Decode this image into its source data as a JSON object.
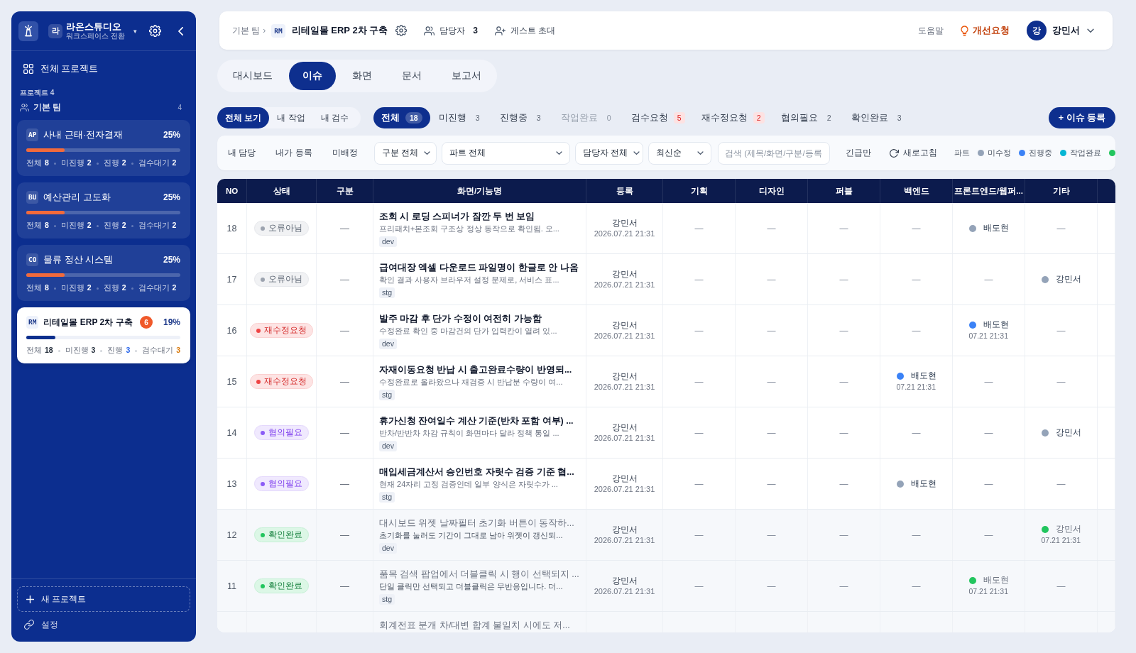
{
  "sidebar": {
    "workspace": {
      "initial": "라",
      "name": "라온스튜디오",
      "subtitle": "워크스페이스 전환",
      "caret": "▾"
    },
    "nav": {
      "label": "전체 프로젝트"
    },
    "section_label": "프로젝트 4",
    "team": {
      "name": "기본 팀",
      "count": "4"
    },
    "projects": [
      {
        "code": "AP",
        "name": "사내 근태·전자결재",
        "percent": "25%",
        "level": 0.25,
        "selected": false,
        "stats": [
          {
            "kind": "total",
            "label": "전체",
            "value": "8"
          },
          {
            "kind": "todo",
            "label": "미진행",
            "value": "2"
          },
          {
            "kind": "doing",
            "label": "진행",
            "value": "2"
          },
          {
            "kind": "review",
            "label": "검수대기",
            "value": "2"
          }
        ]
      },
      {
        "code": "BU",
        "name": "예산관리 고도화",
        "percent": "25%",
        "level": 0.25,
        "selected": false,
        "stats": [
          {
            "kind": "total",
            "label": "전체",
            "value": "8"
          },
          {
            "kind": "todo",
            "label": "미진행",
            "value": "2"
          },
          {
            "kind": "doing",
            "label": "진행",
            "value": "2"
          },
          {
            "kind": "review",
            "label": "검수대기",
            "value": "2"
          }
        ]
      },
      {
        "code": "CO",
        "name": "물류 정산 시스템",
        "percent": "25%",
        "level": 0.25,
        "selected": false,
        "stats": [
          {
            "kind": "total",
            "label": "전체",
            "value": "8"
          },
          {
            "kind": "todo",
            "label": "미진행",
            "value": "2"
          },
          {
            "kind": "doing",
            "label": "진행",
            "value": "2"
          },
          {
            "kind": "review",
            "label": "검수대기",
            "value": "2"
          }
        ]
      },
      {
        "code": "RM",
        "name": "리테일몰 ERP 2차 구축",
        "badge": "6",
        "percent": "19%",
        "level": 0.19,
        "selected": true,
        "stats": [
          {
            "kind": "total",
            "label": "전체",
            "value": "18"
          },
          {
            "kind": "todo",
            "label": "미진행",
            "value": "3"
          },
          {
            "kind": "doing",
            "label": "진행",
            "value": "3"
          },
          {
            "kind": "review",
            "label": "검수대기",
            "value": "3"
          }
        ]
      }
    ],
    "new_project": "새 프로젝트",
    "settings": "설정"
  },
  "topbar": {
    "breadcrumb": {
      "parent": "기본 팀",
      "separator": "›",
      "code": "RM",
      "title": "리테일몰 ERP 2차 구축"
    },
    "members": {
      "label": "담당자",
      "count": "3"
    },
    "invite": "게스트 초대",
    "help": "도움말",
    "feedback": "개선요청",
    "user": {
      "initial": "강",
      "name": "강민서"
    }
  },
  "tabs": [
    {
      "label": "대시보드",
      "selected": false
    },
    {
      "label": "이슈",
      "selected": true
    },
    {
      "label": "화면",
      "selected": false
    },
    {
      "label": "문서",
      "selected": false
    },
    {
      "label": "보고서",
      "selected": false
    }
  ],
  "scope_filters": [
    {
      "label": "전체 보기",
      "selected": true
    },
    {
      "label": "내 작업",
      "selected": false
    },
    {
      "label": "내 검수",
      "selected": false
    }
  ],
  "status_filters": [
    {
      "label": "전체",
      "count": "18",
      "selected": true,
      "alert": false,
      "disabled": false
    },
    {
      "label": "미진행",
      "count": "3",
      "selected": false,
      "alert": false,
      "disabled": false
    },
    {
      "label": "진행중",
      "count": "3",
      "selected": false,
      "alert": false,
      "disabled": false
    },
    {
      "label": "작업완료",
      "count": "0",
      "selected": false,
      "alert": false,
      "disabled": true
    },
    {
      "label": "검수요청",
      "count": "5",
      "selected": false,
      "alert": true,
      "disabled": false
    },
    {
      "label": "재수정요청",
      "count": "2",
      "selected": false,
      "alert": true,
      "disabled": false
    },
    {
      "label": "협의필요",
      "count": "2",
      "selected": false,
      "alert": false,
      "disabled": false
    },
    {
      "label": "확인완료",
      "count": "3",
      "selected": false,
      "alert": false,
      "disabled": false
    }
  ],
  "new_issue_button": "+ 이슈 등록",
  "toolbar": {
    "quick_filters": [
      "내 담당",
      "내가 등록",
      "미배정"
    ],
    "dropdowns": [
      {
        "label": "구분 전체"
      },
      {
        "label": "파트 전체"
      },
      {
        "label": "담당자 전체"
      },
      {
        "label": "최신순"
      }
    ],
    "search": {
      "placeholder": "검색 (제목/화면/구분/등록"
    },
    "urgent_toggle": "긴급만",
    "refresh": "새로고침",
    "legend": {
      "label": "파트",
      "items": [
        {
          "label": "미수정",
          "color": "#94a3b8"
        },
        {
          "label": "진행중",
          "color": "#3b82f6"
        },
        {
          "label": "작업완료",
          "color": "#06b6d4"
        },
        {
          "color": "#22c55e"
        }
      ]
    }
  },
  "table": {
    "columns": [
      "NO",
      "상태",
      "구분",
      "화면/기능명",
      "등록",
      "기획",
      "디자인",
      "퍼블",
      "백엔드",
      "프론트엔드/웹퍼...",
      "기타"
    ],
    "rows": [
      {
        "no": "18",
        "status": {
          "kind": "not_bug",
          "label": "오류아님"
        },
        "category": "—",
        "title": "조회 시 로딩 스피너가 잠깐 두 번 보임",
        "description": "프리패치+본조회 구조상 정상 동작으로 확인됨. 오...",
        "env": "dev",
        "registrar": "강민서",
        "registered_at": "2026.07.21 21:31",
        "done": false,
        "parts": [
          "—",
          "—",
          "—",
          "—",
          {
            "name": "배도현",
            "color": "#94a3b8"
          },
          "—"
        ]
      },
      {
        "no": "17",
        "status": {
          "kind": "not_bug",
          "label": "오류아님"
        },
        "category": "—",
        "title": "급여대장 엑셀 다운로드 파일명이 한글로 안 나옴",
        "description": "확인 결과 사용자 브라우저 설정 문제로, 서비스 표...",
        "env": "stg",
        "registrar": "강민서",
        "registered_at": "2026.07.21 21:31",
        "done": false,
        "parts": [
          "—",
          "—",
          "—",
          "—",
          "—",
          {
            "name": "강민서",
            "color": "#94a3b8"
          }
        ]
      },
      {
        "no": "16",
        "status": {
          "kind": "rework",
          "label": "재수정요청"
        },
        "category": "—",
        "title": "발주 마감 후 단가 수정이 여전히 가능함",
        "description": "수정완료 확인 중 마감건의 단가 입력칸이 열려 있...",
        "env": "dev",
        "registrar": "강민서",
        "registered_at": "2026.07.21 21:31",
        "done": false,
        "parts": [
          "—",
          "—",
          "—",
          "—",
          {
            "name": "배도현",
            "color": "#3b82f6",
            "date": "07.21 21:31"
          },
          "—"
        ]
      },
      {
        "no": "15",
        "status": {
          "kind": "rework",
          "label": "재수정요청"
        },
        "category": "—",
        "title": "자재이동요청 반납 시 출고완료수량이 반영되...",
        "description": "수정완료로 올라왔으나 재검증 시 반납분 수량이 여...",
        "env": "stg",
        "registrar": "강민서",
        "registered_at": "2026.07.21 21:31",
        "done": false,
        "parts": [
          "—",
          "—",
          "—",
          {
            "name": "배도현",
            "color": "#3b82f6",
            "date": "07.21 21:31"
          },
          "—",
          "—"
        ]
      },
      {
        "no": "14",
        "status": {
          "kind": "discuss",
          "label": "협의필요"
        },
        "category": "—",
        "title": "휴가신청 잔여일수 계산 기준(반차 포함 여부) ...",
        "description": "반차/반반차 차감 규칙이 화면마다 달라 정책 통일 ...",
        "env": "dev",
        "registrar": "강민서",
        "registered_at": "2026.07.21 21:31",
        "done": false,
        "parts": [
          "—",
          "—",
          "—",
          "—",
          "—",
          {
            "name": "강민서",
            "color": "#94a3b8"
          }
        ]
      },
      {
        "no": "13",
        "status": {
          "kind": "discuss",
          "label": "협의필요"
        },
        "category": "—",
        "title": "매입세금계산서 승인번호 자릿수 검증 기준 협...",
        "description": "현재 24자리 고정 검증인데 일부 양식은 자릿수가 ...",
        "env": "stg",
        "registrar": "강민서",
        "registered_at": "2026.07.21 21:31",
        "done": false,
        "parts": [
          "—",
          "—",
          "—",
          {
            "name": "배도현",
            "color": "#94a3b8"
          },
          "—",
          "—"
        ]
      },
      {
        "no": "12",
        "status": {
          "kind": "confirmed",
          "label": "확인완료"
        },
        "category": "—",
        "title": "대시보드 위젯 날짜필터 초기화 버튼이 동작하...",
        "description": "초기화를 눌러도 기간이 그대로 남아 위젯이 갱신되...",
        "env": "dev",
        "registrar": "강민서",
        "registered_at": "2026.07.21 21:31",
        "done": true,
        "parts": [
          "—",
          "—",
          "—",
          "—",
          "—",
          {
            "name": "강민서",
            "color": "#22c55e",
            "date": "07.21 21:31"
          }
        ]
      },
      {
        "no": "11",
        "status": {
          "kind": "confirmed",
          "label": "확인완료"
        },
        "category": "—",
        "title": "품목 검색 팝업에서 더블클릭 시 행이 선택되지 ...",
        "description": "단일 클릭만 선택되고 더블클릭은 무반응입니다. 더...",
        "env": "stg",
        "registrar": "강민서",
        "registered_at": "2026.07.21 21:31",
        "done": true,
        "parts": [
          "—",
          "—",
          "—",
          "—",
          {
            "name": "배도현",
            "color": "#22c55e",
            "date": "07.21 21:31"
          },
          "—"
        ]
      },
      {
        "title": "회계전표 분개 차/대변 합계 불일치 시에도 저...",
        "done": true
      }
    ]
  }
}
